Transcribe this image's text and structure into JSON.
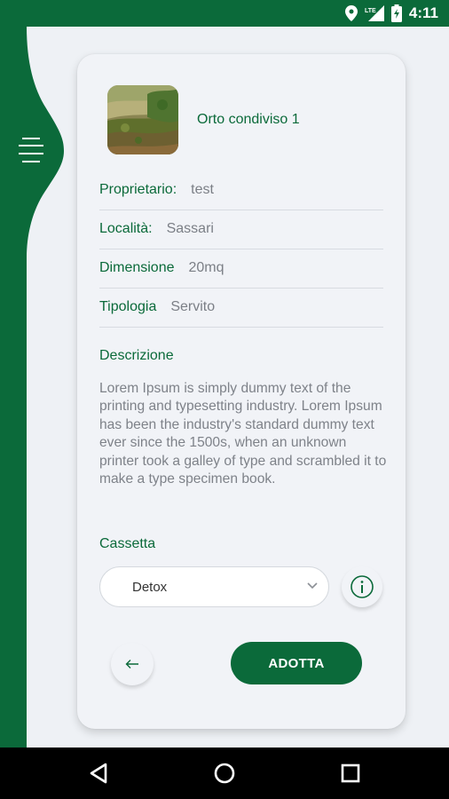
{
  "status_bar": {
    "time": "4:11",
    "network": "LTE"
  },
  "sidebar": {
    "menu_icon": "menu-icon"
  },
  "garden": {
    "title": "Orto condiviso 1",
    "details": [
      {
        "label": "Proprietario:",
        "value": "test"
      },
      {
        "label": "Località:",
        "value": "Sassari"
      },
      {
        "label": "Dimensione",
        "value": "20mq"
      },
      {
        "label": "Tipologia",
        "value": "Servito"
      }
    ],
    "description_label": "Descrizione",
    "description": "Lorem Ipsum is simply dummy text of the printing and typesetting industry. Lorem Ipsum has been the industry's standard dummy text ever since the 1500s, when an unknown printer took a galley of type and scrambled it to make a type specimen book.",
    "cassetta_label": "Cassetta",
    "cassetta_selected": "Detox"
  },
  "actions": {
    "back_icon": "arrow-left-icon",
    "info_icon": "info-icon",
    "adopt_label": "ADOTTA"
  },
  "colors": {
    "primary": "#0b6a3a",
    "background": "#eef1f5",
    "card": "#f1f3f7",
    "muted_text": "#7b7f86"
  }
}
